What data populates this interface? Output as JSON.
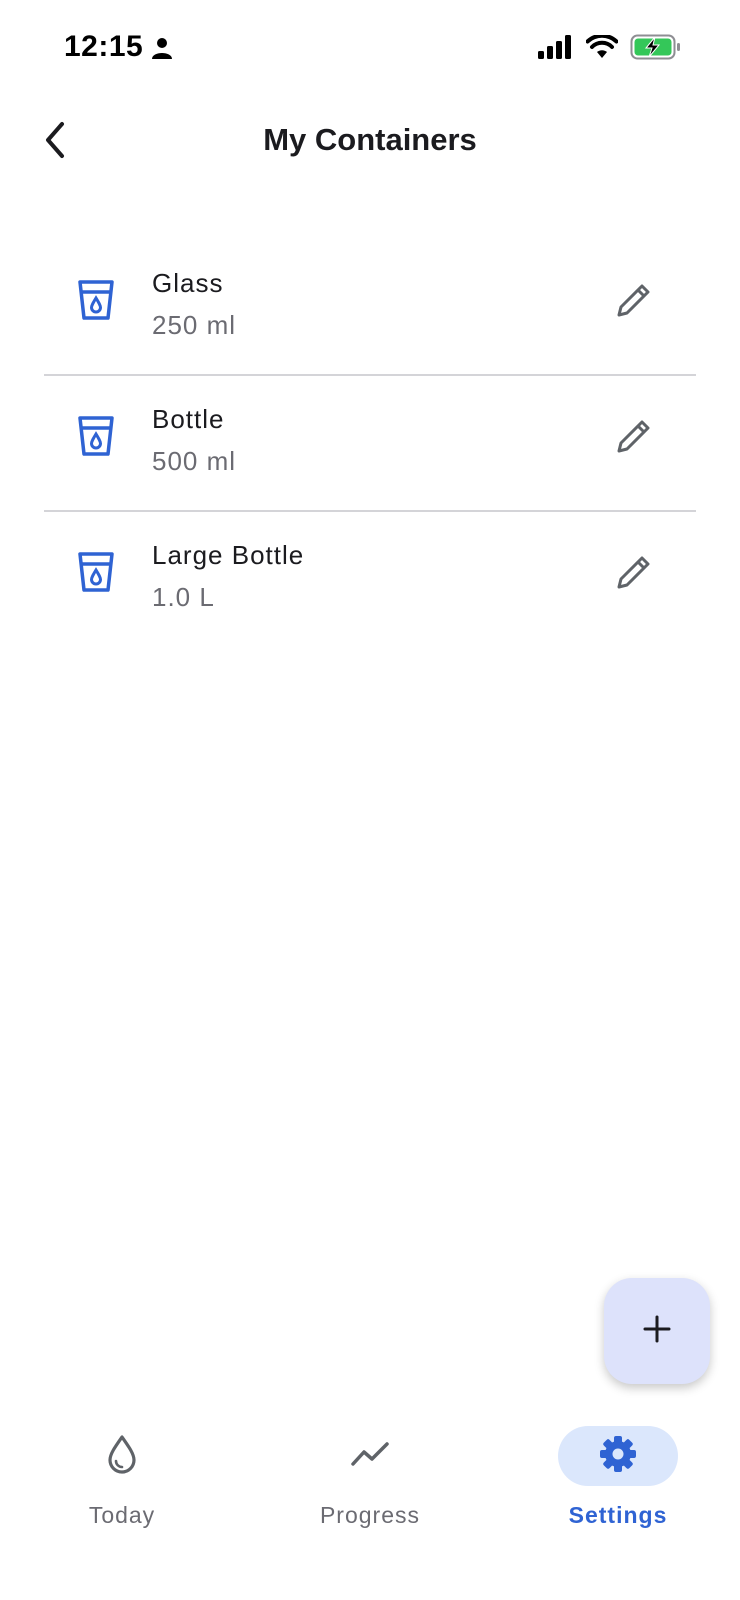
{
  "status_bar": {
    "time": "12:15",
    "icons": [
      "person-icon",
      "signal-icon",
      "wifi-icon",
      "battery-charging-icon"
    ],
    "battery_color": "#34c759"
  },
  "header": {
    "title": "My Containers",
    "back_icon": "chevron-left-icon"
  },
  "containers": [
    {
      "name": "Glass",
      "size": "250 ml",
      "icon": "cup-water-icon"
    },
    {
      "name": "Bottle",
      "size": "500 ml",
      "icon": "cup-water-icon"
    },
    {
      "name": "Large Bottle",
      "size": "1.0 L",
      "icon": "cup-water-icon"
    }
  ],
  "fab": {
    "icon": "plus-icon"
  },
  "bottom_nav": {
    "items": [
      {
        "label": "Today",
        "icon": "water-drop-icon",
        "active": false
      },
      {
        "label": "Progress",
        "icon": "trend-line-icon",
        "active": false
      },
      {
        "label": "Settings",
        "icon": "gear-icon",
        "active": true
      }
    ]
  },
  "colors": {
    "accent": "#2f63d3",
    "active_pill": "#dbe7fc",
    "fab_background": "#dde2fb",
    "divider": "#d4d4d8",
    "secondary_text": "#6b6b72"
  }
}
